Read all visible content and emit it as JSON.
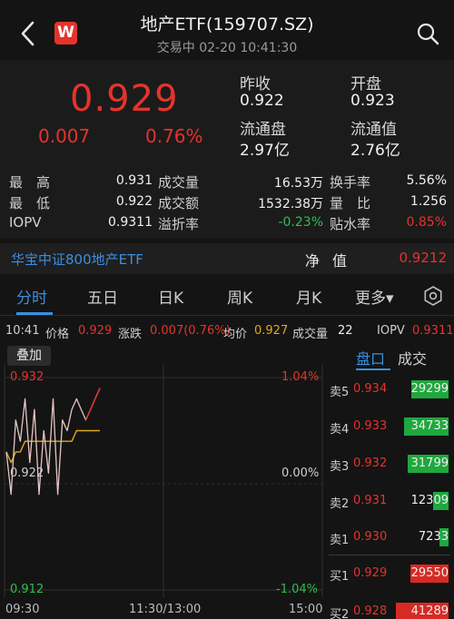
{
  "header": {
    "title": "地产ETF(159707.SZ)",
    "subtitle": "交易中 02-20 10:41:30",
    "logo_letter": "W"
  },
  "quote": {
    "price": "0.929",
    "change": "0.007",
    "change_pct": "0.76%",
    "prev_close_label": "昨收",
    "prev_close": "0.922",
    "open_label": "开盘",
    "open": "0.923",
    "float_shares_label": "流通盘",
    "float_shares": "2.97亿",
    "float_value_label": "流通值",
    "float_value": "2.76亿"
  },
  "stats": {
    "high_label": "最　高",
    "high": "0.931",
    "volume_label": "成交量",
    "volume": "16.53万",
    "turnover_label": "换手率",
    "turnover": "5.56%",
    "low_label": "最　低",
    "low": "0.922",
    "amount_label": "成交额",
    "amount": "1532.38万",
    "vol_ratio_label": "量　比",
    "vol_ratio": "1.256",
    "iopv_label": "IOPV",
    "iopv": "0.9311",
    "premium_label": "溢折率",
    "premium": "-0.23%",
    "discount_label": "贴水率",
    "discount": "0.85%"
  },
  "fund": {
    "name": "华宝中证800地产ETF",
    "nav_label": "净值",
    "nav": "0.9212"
  },
  "tabs": [
    {
      "label": "分时",
      "active": true
    },
    {
      "label": "五日",
      "active": false
    },
    {
      "label": "日K",
      "active": false
    },
    {
      "label": "周K",
      "active": false
    },
    {
      "label": "月K",
      "active": false
    },
    {
      "label": "更多▾",
      "active": false
    }
  ],
  "info": {
    "time": "10:41",
    "price_label": "价格",
    "price": "0.929",
    "chg_label": "涨跌",
    "chg": "0.007(0.76%)",
    "avg_label": "均价",
    "avg": "0.927",
    "vol_label": "成交量",
    "vol": "22",
    "iopv_label": "IOPV",
    "iopv": "0.9311"
  },
  "chart": {
    "overlay_label": "叠加",
    "y_top": "0.932",
    "y_mid": "0.922",
    "y_bottom": "0.912",
    "pct_top": "1.04%",
    "pct_mid": "0.00%",
    "pct_bottom": "-1.04%",
    "x_start": "09:30",
    "x_mid": "11:30/13:00",
    "x_end": "15:00"
  },
  "chart_data": {
    "type": "line",
    "title": "",
    "xlabel": "",
    "ylabel": "",
    "ylim": [
      0.912,
      0.932
    ],
    "x_ticks": [
      "09:30",
      "11:30/13:00",
      "15:00"
    ],
    "series": [
      {
        "name": "价格",
        "values": [
          0.925,
          0.921,
          0.928,
          0.926,
          0.93,
          0.924,
          0.929,
          0.921,
          0.927,
          0.923,
          0.93,
          0.921,
          0.928,
          0.927,
          0.929,
          0.93,
          0.929,
          0.928,
          0.929,
          0.93,
          0.931
        ]
      },
      {
        "name": "均价",
        "values": [
          0.925,
          0.924,
          0.925,
          0.925,
          0.926,
          0.926,
          0.926,
          0.926,
          0.926,
          0.926,
          0.926,
          0.926,
          0.926,
          0.926,
          0.926,
          0.927,
          0.927,
          0.927,
          0.927,
          0.927,
          0.927
        ]
      }
    ],
    "grid": true,
    "colors": {
      "price": "#e8c4c4",
      "avg": "#e0a820",
      "price_red": "#e5332c"
    }
  },
  "orderbook": {
    "tab_active": "盘口",
    "tab_other": "成交",
    "rows": [
      {
        "label": "卖5",
        "price": "0.934",
        "volume": "29299",
        "bar": 0.71,
        "side": "ask"
      },
      {
        "label": "卖4",
        "price": "0.933",
        "volume": "34733",
        "bar": 0.84,
        "side": "ask"
      },
      {
        "label": "卖3",
        "price": "0.932",
        "volume": "31799",
        "bar": 0.77,
        "side": "ask"
      },
      {
        "label": "卖2",
        "price": "0.931",
        "volume": "12309",
        "bar": 0.3,
        "side": "ask"
      },
      {
        "label": "卖1",
        "price": "0.930",
        "volume": "7233",
        "bar": 0.18,
        "side": "ask"
      },
      {
        "label": "买1",
        "price": "0.929",
        "volume": "29550",
        "bar": 0.72,
        "side": "bid"
      },
      {
        "label": "买2",
        "price": "0.928",
        "volume": "41289",
        "bar": 1.0,
        "side": "bid"
      }
    ]
  },
  "colors": {
    "up": "#e5332c",
    "down": "#2fbf4a",
    "accent": "#3b8fe0",
    "background": "#141414"
  }
}
